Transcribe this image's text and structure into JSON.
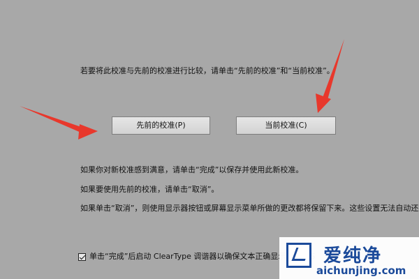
{
  "intro": "若要将此校准与先前的校准进行比较，请单击“先前的校准”和“当前校准”。",
  "buttons": {
    "previous": "先前的校准(P)",
    "current": "当前校准(C)"
  },
  "instructions": [
    "如果你对新校准感到满意，请单击“完成”以保存并使用此新校准。",
    "如果要使用先前的校准，请单击“取消”。",
    "如果单击“取消”，则使用显示器按钮或屏幕显示菜单所做的更改都将保留下来。这些设置无法自动还原。"
  ],
  "checkbox": {
    "checked": true,
    "label": "单击“完成”后启动 ClearType 调谐器以确保文本正确显示(推荐)(S"
  },
  "watermark": {
    "brand": "爱纯净",
    "domain": "aichunjing.com"
  },
  "colors": {
    "arrow": "#e8382c",
    "brand": "#1b4a9a"
  }
}
